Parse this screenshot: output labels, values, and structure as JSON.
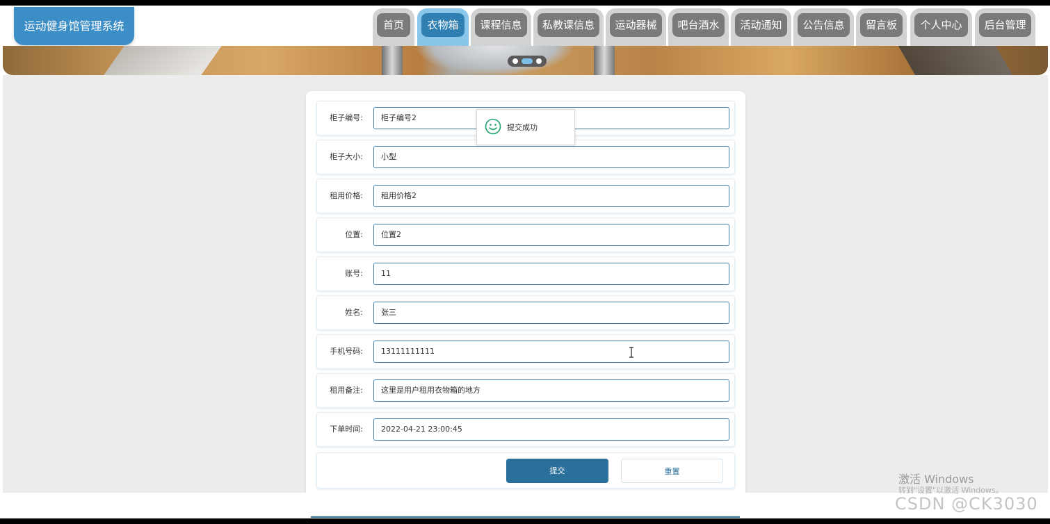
{
  "header": {
    "brand": "运动健身馆管理系统",
    "nav": [
      {
        "label": "首页",
        "active": false
      },
      {
        "label": "衣物箱",
        "active": true
      },
      {
        "label": "课程信息",
        "active": false
      },
      {
        "label": "私教课信息",
        "active": false
      },
      {
        "label": "运动器械",
        "active": false
      },
      {
        "label": "吧台酒水",
        "active": false
      },
      {
        "label": "活动通知",
        "active": false
      },
      {
        "label": "公告信息",
        "active": false
      },
      {
        "label": "留言板",
        "active": false
      },
      {
        "label": "个人中心",
        "active": false
      },
      {
        "label": "后台管理",
        "active": false
      }
    ]
  },
  "form": {
    "fields": [
      {
        "label": "柜子编号:",
        "value": "柜子编号2"
      },
      {
        "label": "柜子大小:",
        "value": "小型"
      },
      {
        "label": "租用价格:",
        "value": "租用价格2"
      },
      {
        "label": "位置:",
        "value": "位置2"
      },
      {
        "label": "账号:",
        "value": "11"
      },
      {
        "label": "姓名:",
        "value": "张三"
      },
      {
        "label": "手机号码:",
        "value": "13111111111"
      },
      {
        "label": "租用备注:",
        "value": "这里是用户租用衣物箱的地方"
      },
      {
        "label": "下单时间:",
        "value": "2022-04-21 23:00:45"
      }
    ],
    "submit_label": "提交",
    "reset_label": "重置"
  },
  "toast": {
    "message": "提交成功",
    "icon": "smile-icon"
  },
  "overlay": {
    "windows_activation": "激活 Windows",
    "windows_activation_hint": "转到\"设置\"以激活 Windows。",
    "csdn_watermark": "CSDN @CK3030"
  },
  "colors": {
    "accent": "#2f7fb3",
    "button": "#2b6f9b",
    "brand_bg": "#3c8ec7"
  }
}
